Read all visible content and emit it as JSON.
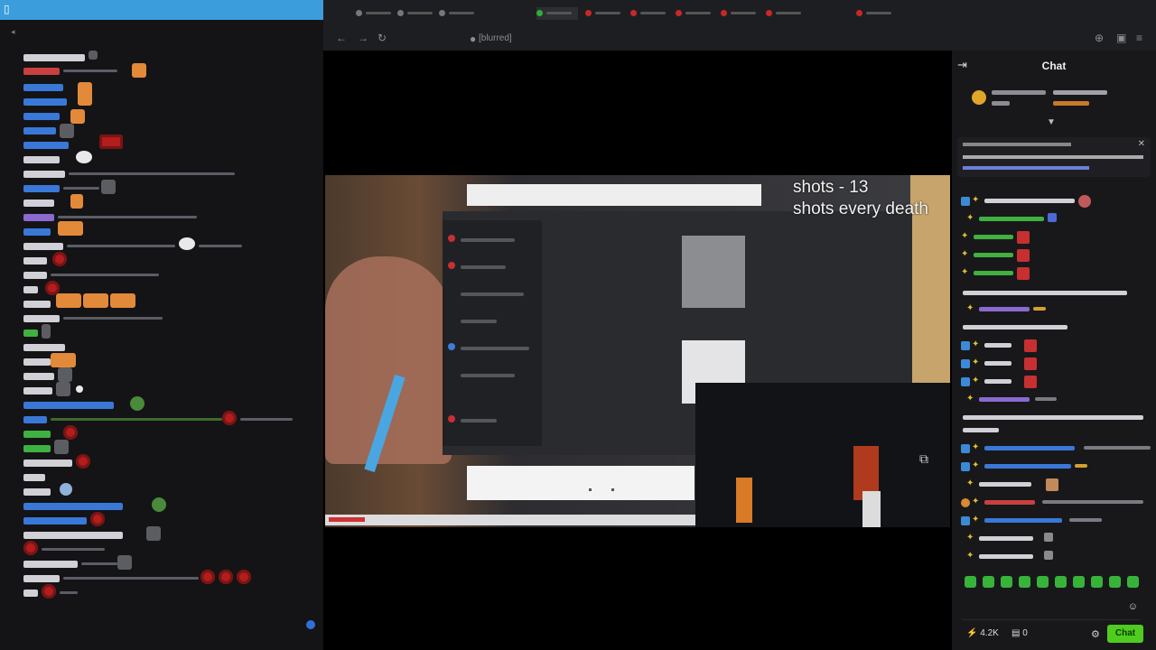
{
  "browser": {
    "tabs": [
      "",
      "",
      "",
      "",
      "",
      "",
      "",
      "",
      "",
      ""
    ],
    "url": "[blurred]"
  },
  "video": {
    "overlay_line1": "shots - 13",
    "overlay_line2": "shots every death"
  },
  "chat": {
    "title": "Chat",
    "pinned_text": "[blurred]",
    "points": "4.2K",
    "viewers": "0",
    "chat_button_label": "Chat"
  },
  "colors": {
    "accent": "#3b9ddb",
    "chat_button": "#4fcc1f",
    "emote_red": "#c73030"
  },
  "icons": {
    "collapse": "collapse-chat-icon",
    "settings": "gear-icon",
    "pip": "picture-in-picture-icon",
    "back": "arrow-left-icon",
    "forward": "arrow-right-icon",
    "reload": "reload-icon"
  }
}
